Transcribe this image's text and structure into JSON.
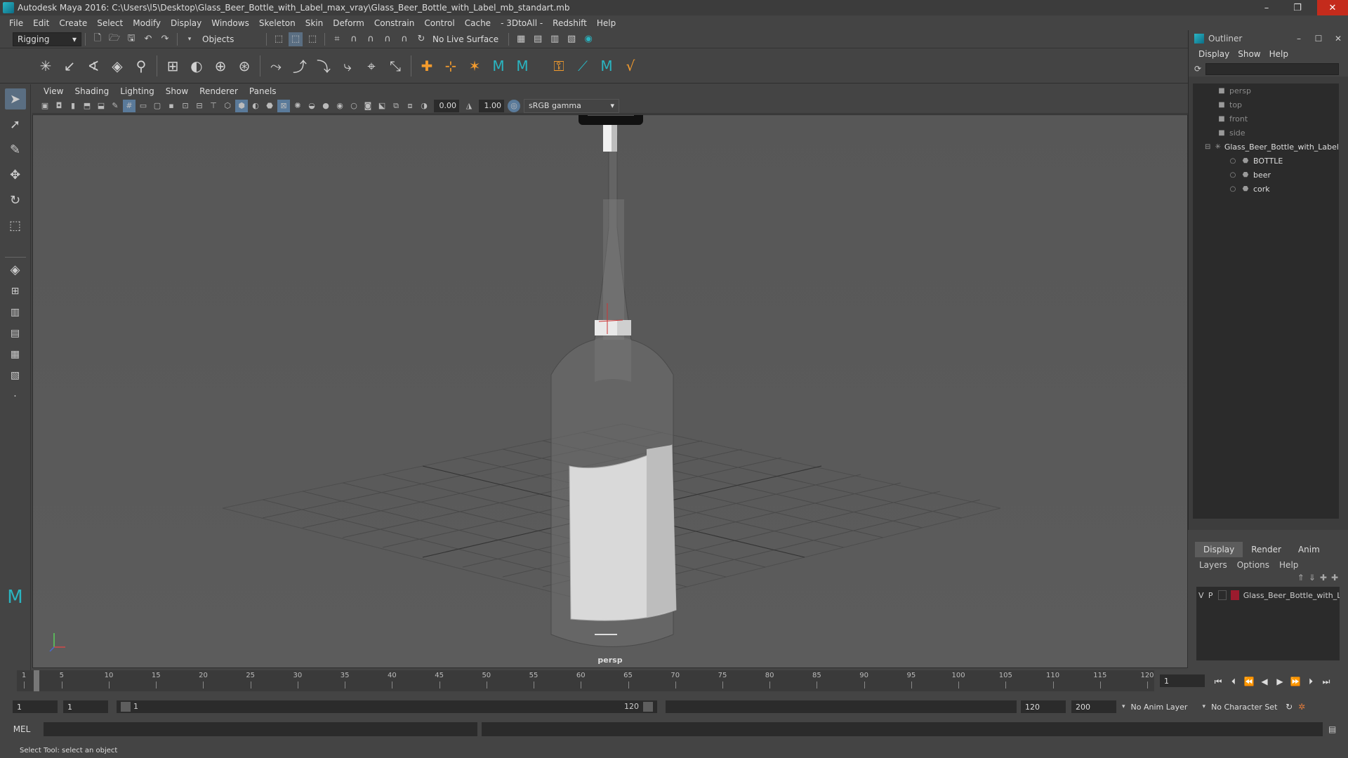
{
  "window": {
    "title": "Autodesk Maya 2016: C:\\Users\\l5\\Desktop\\Glass_Beer_Bottle_with_Label_max_vray\\Glass_Beer_Bottle_with_Label_mb_standart.mb",
    "minimize": "–",
    "restore": "❐",
    "close": "✕"
  },
  "menubar": [
    "File",
    "Edit",
    "Create",
    "Select",
    "Modify",
    "Display",
    "Windows",
    "Skeleton",
    "Skin",
    "Deform",
    "Constrain",
    "Control",
    "Cache",
    "- 3DtoAll -",
    "Redshift",
    "Help"
  ],
  "statusline": {
    "mode": "Rigging",
    "selection_mode": "Objects",
    "live_surface": "No Live Surface"
  },
  "viewport": {
    "menu": [
      "View",
      "Shading",
      "Lighting",
      "Show",
      "Renderer",
      "Panels"
    ],
    "exposure": "0.00",
    "gamma": "1.00",
    "color_space": "sRGB gamma",
    "camera_label": "persp"
  },
  "outliner": {
    "title": "Outliner",
    "menu": [
      "Display",
      "Show",
      "Help"
    ],
    "items": [
      {
        "label": "persp",
        "dim": true,
        "indent": 0,
        "icon": "camera-icon"
      },
      {
        "label": "top",
        "dim": true,
        "indent": 0,
        "icon": "camera-icon"
      },
      {
        "label": "front",
        "dim": true,
        "indent": 0,
        "icon": "camera-icon"
      },
      {
        "label": "side",
        "dim": true,
        "indent": 0,
        "icon": "camera-icon"
      },
      {
        "label": "Glass_Beer_Bottle_with_Label",
        "dim": false,
        "indent": 0,
        "icon": "group-icon"
      },
      {
        "label": "BOTTLE",
        "dim": false,
        "indent": 1,
        "icon": "mesh-icon"
      },
      {
        "label": "beer",
        "dim": false,
        "indent": 1,
        "icon": "mesh-icon"
      },
      {
        "label": "cork",
        "dim": false,
        "indent": 1,
        "icon": "mesh-icon"
      }
    ]
  },
  "layer_editor": {
    "tabs": [
      "Display",
      "Render",
      "Anim"
    ],
    "menu": [
      "Layers",
      "Options",
      "Help"
    ],
    "layer": {
      "visible": "V",
      "playback": "P",
      "name": "Glass_Beer_Bottle_with_Label",
      "color": "#9b1b2e"
    }
  },
  "timeline": {
    "ticks": [
      1,
      5,
      10,
      15,
      20,
      25,
      30,
      35,
      40,
      45,
      50,
      55,
      60,
      65,
      70,
      75,
      80,
      85,
      90,
      95,
      100,
      105,
      110,
      115,
      120
    ],
    "current_frame": "1"
  },
  "range": {
    "start": "1",
    "playback_start": "1",
    "slider_start": "1",
    "slider_end": "120",
    "playback_end": "120",
    "end": "200",
    "anim_layer": "No Anim Layer",
    "character_set": "No Character Set"
  },
  "cmdline": {
    "label": "MEL"
  },
  "helpline": {
    "text": "Select Tool: select an object"
  }
}
